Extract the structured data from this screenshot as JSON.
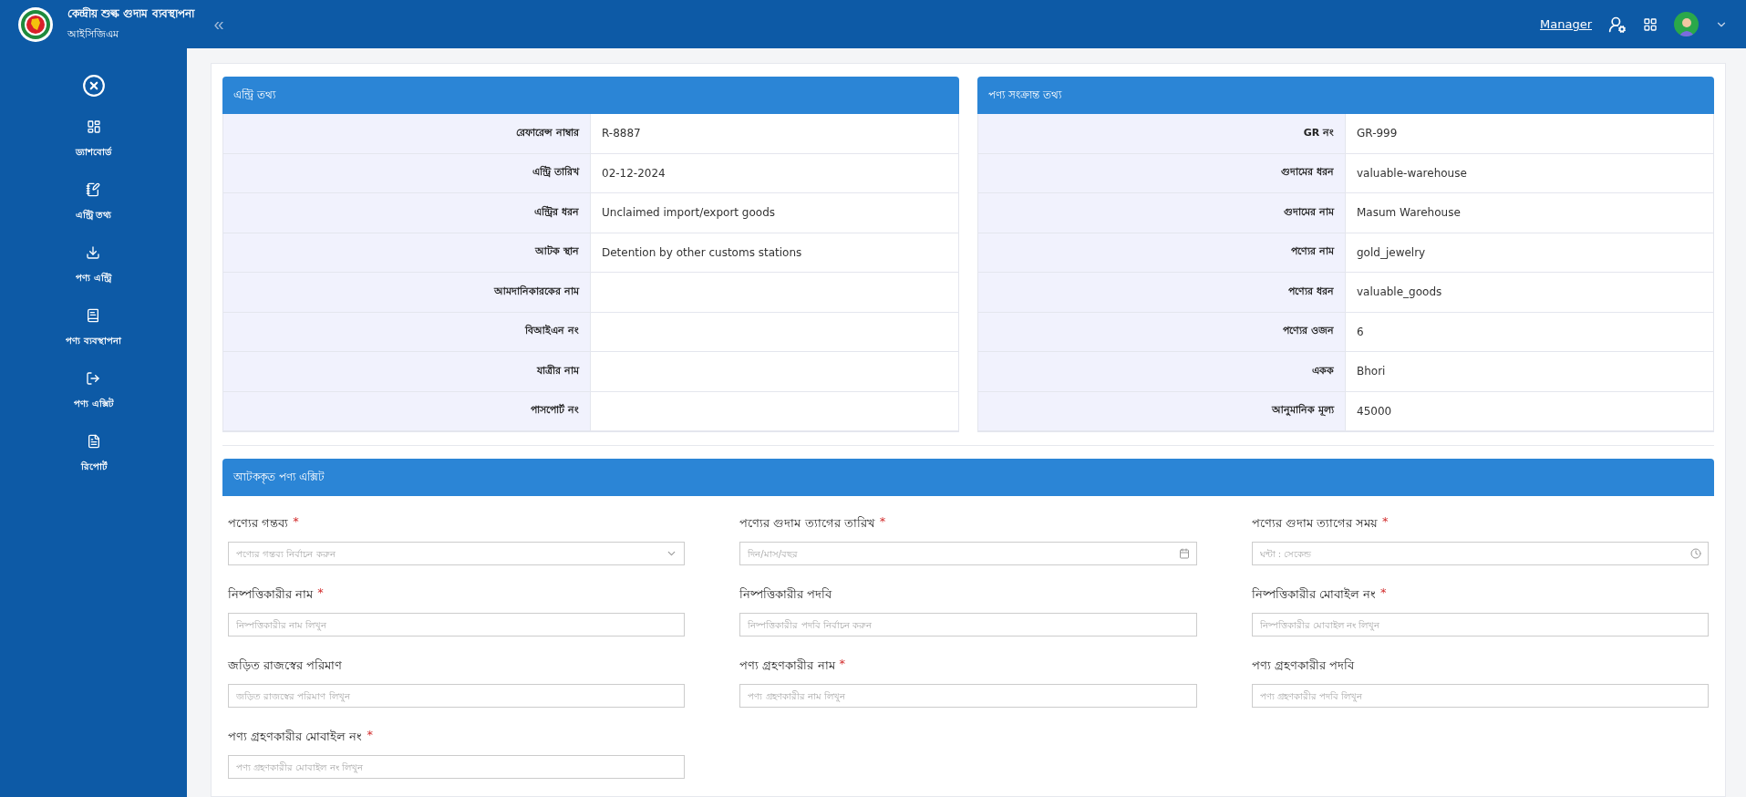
{
  "header": {
    "app_title": "কেন্দ্রীয় শুল্ক গুদাম ব্যবস্থাপনা",
    "app_subtitle": "আইসিজিএম",
    "collapse_icon": "«",
    "role_link": "Manager"
  },
  "sidebar": {
    "items": [
      {
        "label": "ড্যাশবোর্ড",
        "kind": "dashboard"
      },
      {
        "label": "এন্ট্রি তথ্য",
        "kind": "notes"
      },
      {
        "label": "পণ্য এন্ট্রি",
        "kind": "download"
      },
      {
        "label": "পণ্য ব্যবস্থাপনা",
        "kind": "book"
      },
      {
        "label": "পণ্য এক্সিট",
        "kind": "exit"
      },
      {
        "label": "রিপোর্ট",
        "kind": "file"
      }
    ]
  },
  "entry_info": {
    "title": "এন্ট্রি তথ্য",
    "rows": [
      {
        "label": "রেফারেন্স নাম্বার",
        "value": "R-8887"
      },
      {
        "label": "এন্ট্রি তারিখ",
        "value": "02-12-2024"
      },
      {
        "label": "এন্ট্রির ধরন",
        "value": "Unclaimed import/export goods"
      },
      {
        "label": "আটক স্থান",
        "value": "Detention by other customs stations"
      },
      {
        "label": "আমদানিকারকের নাম",
        "value": ""
      },
      {
        "label": "বিআইএন নং",
        "value": ""
      },
      {
        "label": "যাত্রীর নাম",
        "value": ""
      },
      {
        "label": "পাসপোর্ট নং",
        "value": ""
      }
    ]
  },
  "product_info": {
    "title": "পণ্য সংক্রান্ত তথ্য",
    "rows": [
      {
        "label": "**GR** নং",
        "value": "GR-999"
      },
      {
        "label": "গুদামের ধরন",
        "value": "valuable-warehouse"
      },
      {
        "label": "গুদামের নাম",
        "value": "Masum Warehouse"
      },
      {
        "label": "পণ্যের নাম",
        "value": "gold_jewelry"
      },
      {
        "label": "পণ্যের ধরন",
        "value": "valuable_goods"
      },
      {
        "label": "পণ্যের ওজন",
        "value": "6"
      },
      {
        "label": "একক",
        "value": "Bhori"
      },
      {
        "label": "আনুমানিক মূল্য",
        "value": "45000"
      }
    ]
  },
  "exit_form": {
    "title": "আটককৃত পণ্য এক্সিট",
    "fields": [
      {
        "label": "পণ্যের গন্তব্য",
        "marker": "*",
        "kind": "select",
        "placeholder": "পণ্যের গন্তব্য নির্বাচন করুন"
      },
      {
        "label": "পণ্যের গুদাম ত্যাগের তারিখ",
        "marker": "*",
        "kind": "date",
        "placeholder": "দিন/মাস/বছর"
      },
      {
        "label": "পণ্যের গুদাম ত্যাগের সময়",
        "marker": "*",
        "kind": "time",
        "placeholder": "ঘন্টা : সেকেন্ড"
      },
      {
        "label": "নিষ্পত্তিকারীর নাম",
        "marker": "*",
        "kind": "text",
        "placeholder": "নিষ্পত্তিকারীর নাম লিখুন"
      },
      {
        "label": "নিষ্পত্তিকারীর পদবি",
        "kind": "text",
        "placeholder": "নিষ্পত্তিকারীর পদবি নির্বাচন করুন"
      },
      {
        "label": "নিষ্পত্তিকারীর মোবাইল নং",
        "marker": "*",
        "kind": "text",
        "placeholder": "নিষ্পত্তিকারীর মোবাইল নং লিখুন"
      },
      {
        "label": "জড়িত রাজস্বের পরিমাণ",
        "kind": "text",
        "placeholder": "জড়িত রাজস্বের পরিমাণ লিখুন"
      },
      {
        "label": "পণ্য গ্রহণকারীর নাম",
        "marker": "*",
        "kind": "text",
        "placeholder": "পণ্য গ্রহণকারীর নাম লিখুন"
      },
      {
        "label": "পণ্য গ্রহণকারীর পদবি",
        "kind": "text",
        "placeholder": "পণ্য গ্রহণকারীর পদবি লিখুন"
      },
      {
        "label": "পণ্য গ্রহণকারীর মোবাইল নং",
        "marker": "*",
        "kind": "text",
        "placeholder": "পণ্য গ্রহণকারীর মোবাইল নং লিখুন"
      }
    ]
  }
}
